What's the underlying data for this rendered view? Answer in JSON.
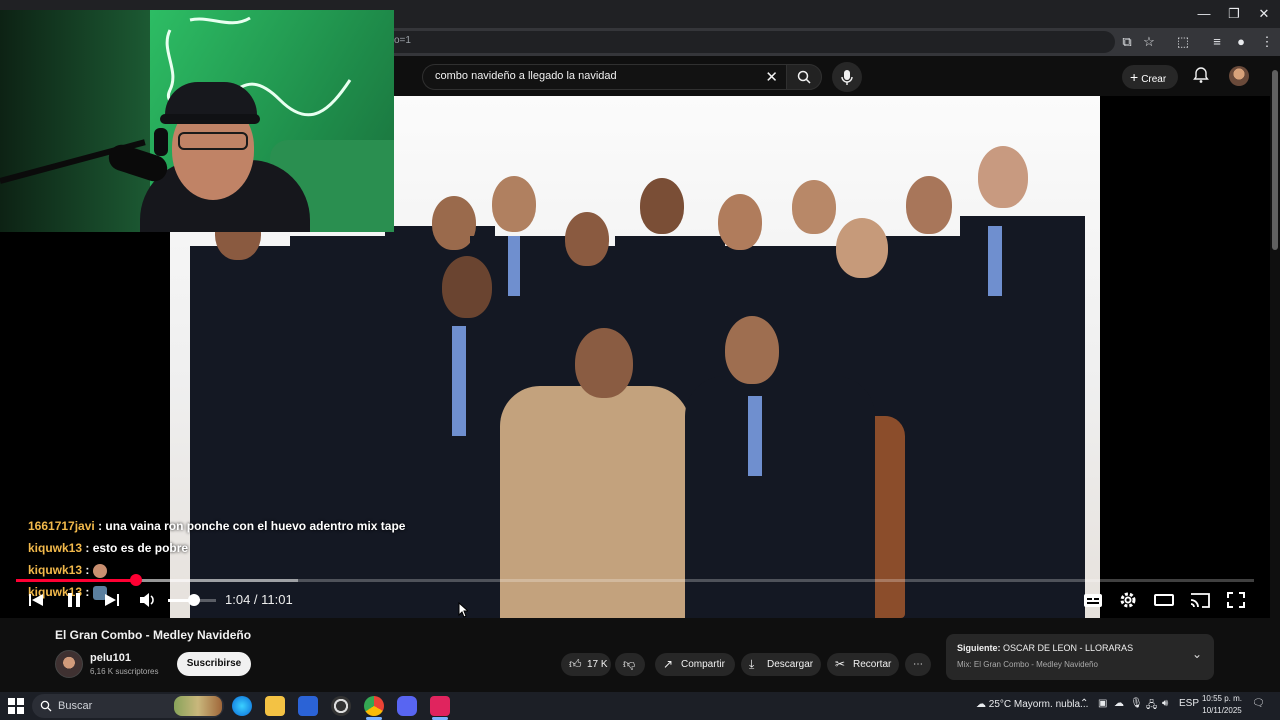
{
  "browser": {
    "url_fragment": "o=1"
  },
  "youtube": {
    "search_query": "combo navideño a llegado la navidad",
    "create_label": "Crear"
  },
  "player": {
    "time_display": "1:04 / 11:01",
    "progress_fraction": 0.097,
    "buffer_fraction": 0.228,
    "volume_fraction": 0.55,
    "chat": [
      {
        "user": "1661717javi",
        "message": ": una vaina ron ponche con el huevo adentro mix tape"
      },
      {
        "user": "kiquwk13",
        "message": ": esto es de pobre"
      },
      {
        "user": "kiquwk13",
        "message": ":"
      },
      {
        "user": "kiquwk13",
        "message": ":"
      }
    ]
  },
  "video": {
    "title": "El Gran Combo - Medley Navideño",
    "channel_name": "pelu101",
    "subscribers": "6,16 K suscriptores",
    "subscribe_label": "Suscribirse",
    "like_count": "17 K",
    "share_label": "Compartir",
    "download_label": "Descargar",
    "clip_label": "Recortar"
  },
  "up_next": {
    "label": "Siguiente:",
    "title": "OSCAR DE LEON - LLORARAS",
    "subtitle": "Mix: El Gran Combo - Medley Navideño"
  },
  "taskbar": {
    "search_placeholder": "Buscar",
    "weather": "25°C  Mayorm. nubla...",
    "language": "ESP",
    "time": "10:55 p. m.",
    "date": "10/11/2025"
  },
  "colors": {
    "youtube_red": "#ff0033",
    "chat_username": "#f2b94b",
    "background": "#0f0f0f"
  }
}
